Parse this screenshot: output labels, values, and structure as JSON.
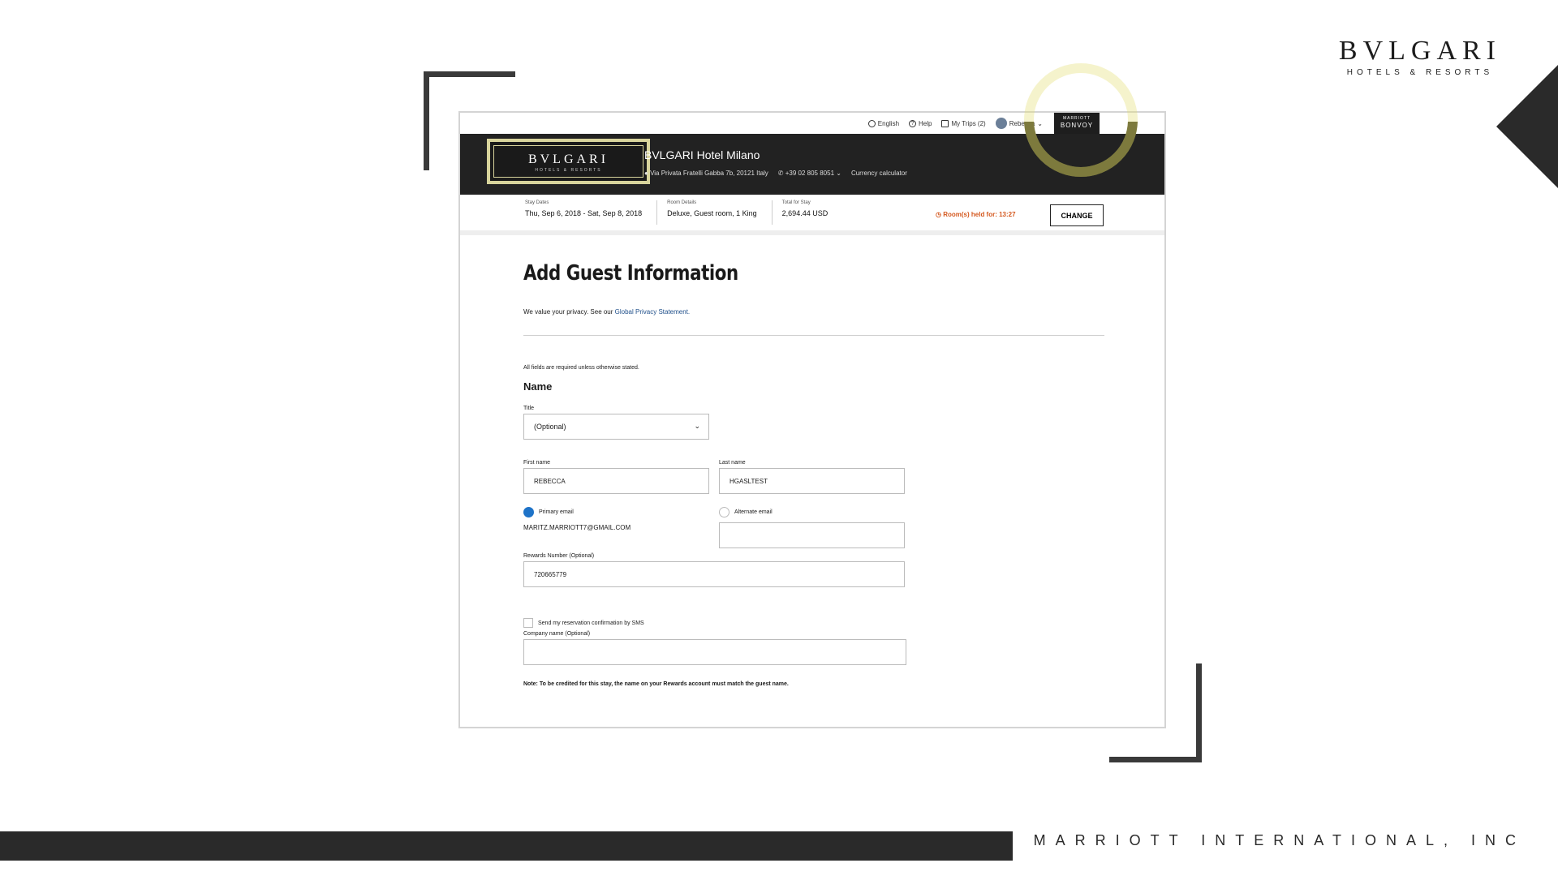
{
  "slide": {
    "brand": {
      "word": "BVLGARI",
      "sub": "HOTELS & RESORTS"
    },
    "footer": "MARRIOTT INTERNATIONAL, INC"
  },
  "nav": {
    "language": "English",
    "help": "Help",
    "trips": "My Trips (2)",
    "user": "Rebecca",
    "bonvoy_small": "MARRIOTT",
    "bonvoy_big": "BONVOY"
  },
  "hotel": {
    "logo_word": "BVLGARI",
    "logo_sub": "HOTELS & RESORTS",
    "name": "BVLGARI Hotel Milano",
    "address": "Via Privata Fratelli Gabba 7b, 20121 Italy",
    "phone": "+39 02 805 8051",
    "currency": "Currency calculator"
  },
  "stay": {
    "dates_label": "Stay Dates",
    "dates_value": "Thu, Sep 6, 2018 - Sat, Sep 8, 2018",
    "room_label": "Room Details",
    "room_value": "Deluxe, Guest room, 1 King",
    "total_label": "Total for Stay",
    "total_value": "2,694.44 USD",
    "held_text": "Room(s) held for: 13:27",
    "change_label": "CHANGE"
  },
  "form": {
    "title": "Add Guest Information",
    "privacy_text": "We value your privacy. See our ",
    "privacy_link": "Global Privacy Statement.",
    "required_note": "All fields are required unless otherwise stated.",
    "section_name": "Name",
    "title_label": "Title",
    "title_value": "(Optional)",
    "first_name_label": "First name",
    "first_name_value": "REBECCA",
    "last_name_label": "Last name",
    "last_name_value": "HGASLTEST",
    "primary_email_label": "Primary email",
    "primary_email_value": "MARITZ.MARRIOTT7@GMAIL.COM",
    "alternate_email_label": "Alternate email",
    "alternate_email_value": "",
    "rewards_label": "Rewards Number (Optional)",
    "rewards_value": "720665779",
    "sms_label": "Send my reservation confirmation by SMS",
    "company_label": "Company name (Optional)",
    "company_value": "",
    "note": "Note: To be credited for this stay, the name on your Rewards account must match the guest name."
  }
}
